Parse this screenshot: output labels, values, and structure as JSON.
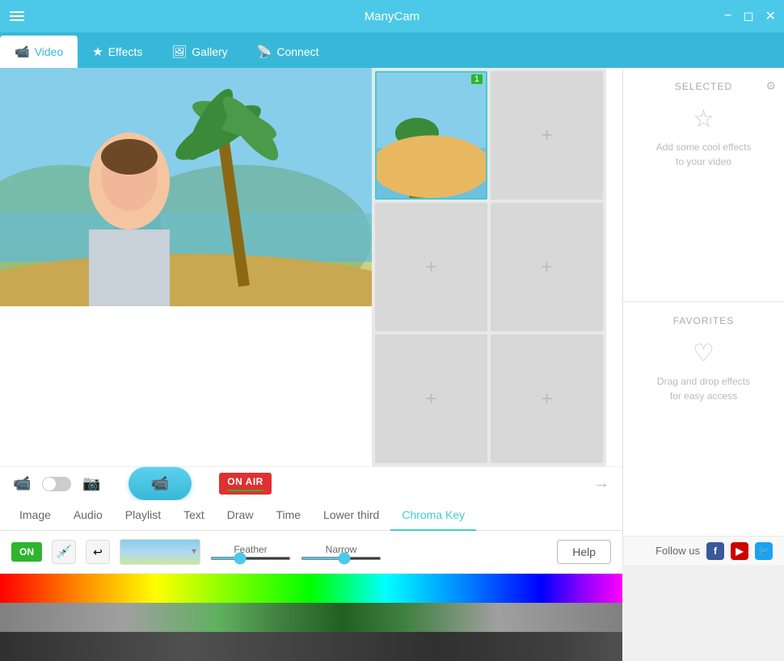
{
  "app": {
    "title": "ManyCam",
    "menu_icon": "hamburger",
    "controls": [
      "minimize",
      "maximize",
      "close"
    ]
  },
  "tabs": {
    "items": [
      {
        "label": "Video",
        "icon": "📹",
        "active": true
      },
      {
        "label": "Effects",
        "icon": "★",
        "active": false
      },
      {
        "label": "Gallery",
        "icon": "🖼",
        "active": false
      },
      {
        "label": "Connect",
        "icon": "📡",
        "active": false
      }
    ]
  },
  "video_grid": {
    "cells": [
      {
        "id": 1,
        "has_content": true,
        "num": "1"
      },
      {
        "id": 2,
        "has_content": false
      },
      {
        "id": 3,
        "has_content": false
      },
      {
        "id": 4,
        "has_content": false
      },
      {
        "id": 5,
        "has_content": false
      },
      {
        "id": 6,
        "has_content": false
      }
    ]
  },
  "controls": {
    "on_air_label": "ON AIR",
    "record_icon": "📹"
  },
  "effect_tabs": {
    "items": [
      {
        "label": "Image",
        "active": false
      },
      {
        "label": "Audio",
        "active": false
      },
      {
        "label": "Playlist",
        "active": false
      },
      {
        "label": "Text",
        "active": false
      },
      {
        "label": "Draw",
        "active": false
      },
      {
        "label": "Time",
        "active": false
      },
      {
        "label": "Lower third",
        "active": false
      },
      {
        "label": "Chroma Key",
        "active": true
      }
    ]
  },
  "chroma_key": {
    "on_label": "ON",
    "feather_label": "Feather",
    "narrow_label": "Narrow",
    "help_label": "Help",
    "feather_value": 35,
    "narrow_value": 55
  },
  "selected_panel": {
    "title": "SELECTED",
    "empty_icon": "★",
    "empty_text": "Add some cool effects\nto your video"
  },
  "favorites_panel": {
    "title": "FAVORITES",
    "empty_icon": "♡",
    "empty_text": "Drag and drop effects\nfor easy access"
  },
  "follow": {
    "label": "Follow us",
    "facebook": "f",
    "youtube": "▶",
    "twitter": "t"
  }
}
